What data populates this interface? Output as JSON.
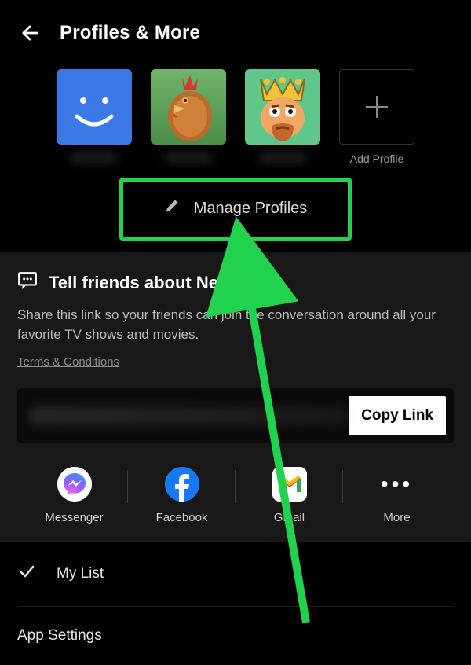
{
  "header": {
    "title": "Profiles & More"
  },
  "profiles": {
    "items": [
      {
        "avatar": "smiley",
        "name": ""
      },
      {
        "avatar": "chicken",
        "name": ""
      },
      {
        "avatar": "king",
        "name": ""
      }
    ],
    "addLabel": "Add Profile"
  },
  "manage": {
    "label": "Manage Profiles"
  },
  "share": {
    "title": "Tell friends about Netflix.",
    "description": "Share this link so your friends can join the conversation around all your favorite TV shows and movies.",
    "termsLabel": "Terms & Conditions",
    "copyLabel": "Copy Link",
    "targets": [
      {
        "icon": "messenger",
        "label": "Messenger"
      },
      {
        "icon": "facebook",
        "label": "Facebook"
      },
      {
        "icon": "gmail",
        "label": "Gmail"
      },
      {
        "icon": "more",
        "label": "More"
      }
    ]
  },
  "menu": {
    "myList": "My List",
    "appSettings": "App Settings"
  },
  "annotation": {
    "color": "#20d24d"
  }
}
